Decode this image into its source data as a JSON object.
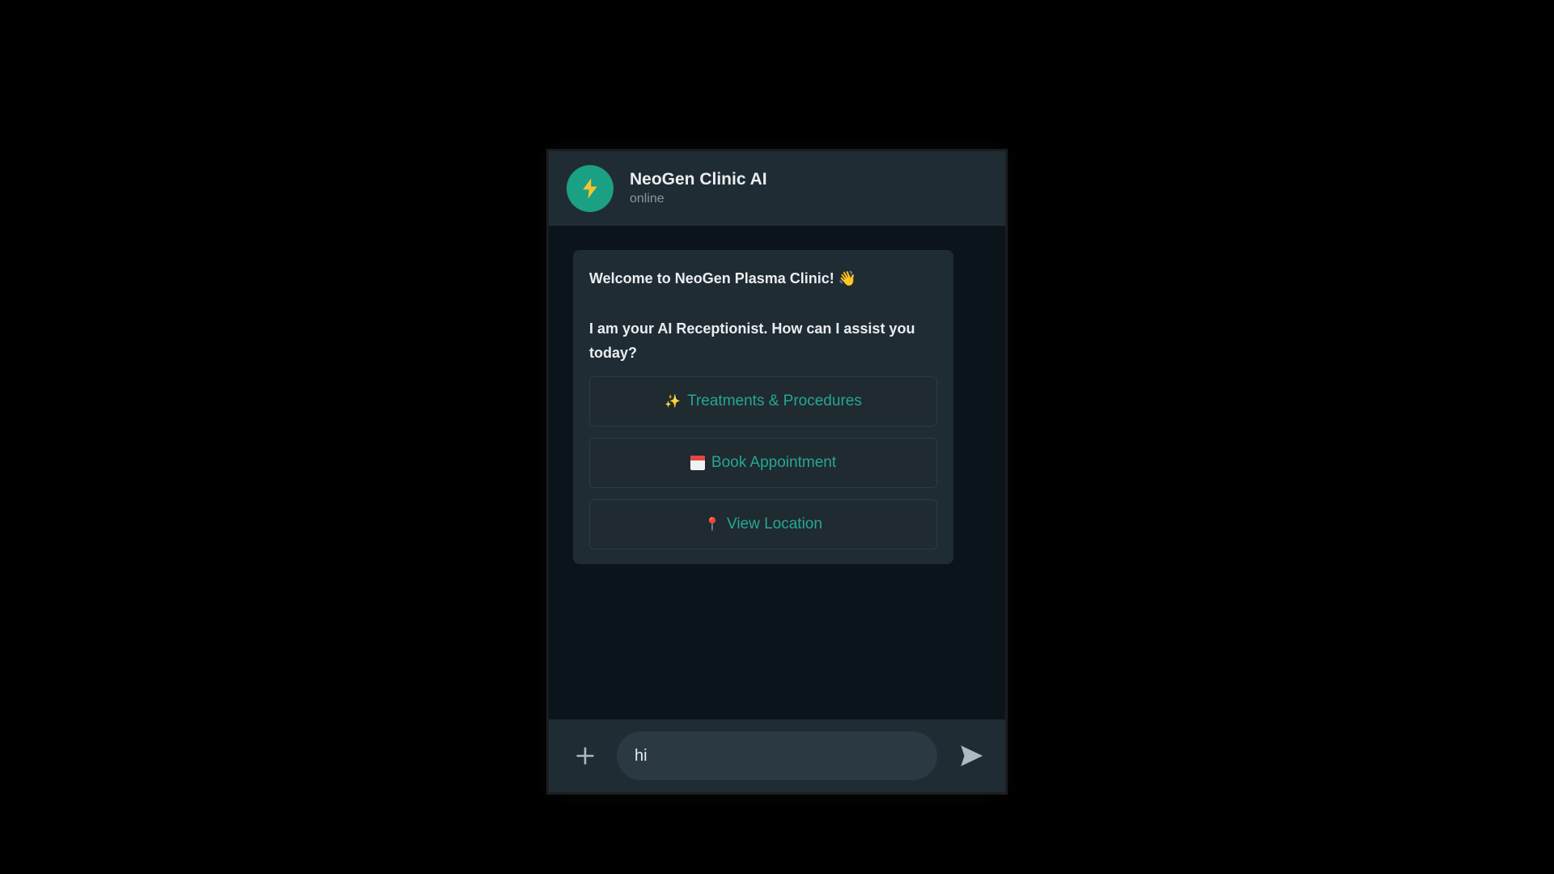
{
  "header": {
    "title": "NeoGen Clinic AI",
    "status": "online",
    "avatar_icon": "lightning-bolt-icon"
  },
  "message": {
    "line1": "Welcome to NeoGen Plasma Clinic! 👋",
    "line2": "I am your AI Receptionist. How can I assist you today?"
  },
  "options": [
    {
      "icon": "sparkles-icon",
      "emoji": "✨",
      "label": "Treatments & Procedures"
    },
    {
      "icon": "calendar-icon",
      "label": "Book Appointment"
    },
    {
      "icon": "pin-icon",
      "emoji": "📍",
      "label": "View Location"
    }
  ],
  "composer": {
    "value": "hi",
    "attach_icon": "plus-icon",
    "send_icon": "send-icon"
  },
  "colors": {
    "accent": "#25a892",
    "avatar": "#1aa083",
    "header_bg": "#202c33",
    "body_bg": "#0b141a"
  }
}
